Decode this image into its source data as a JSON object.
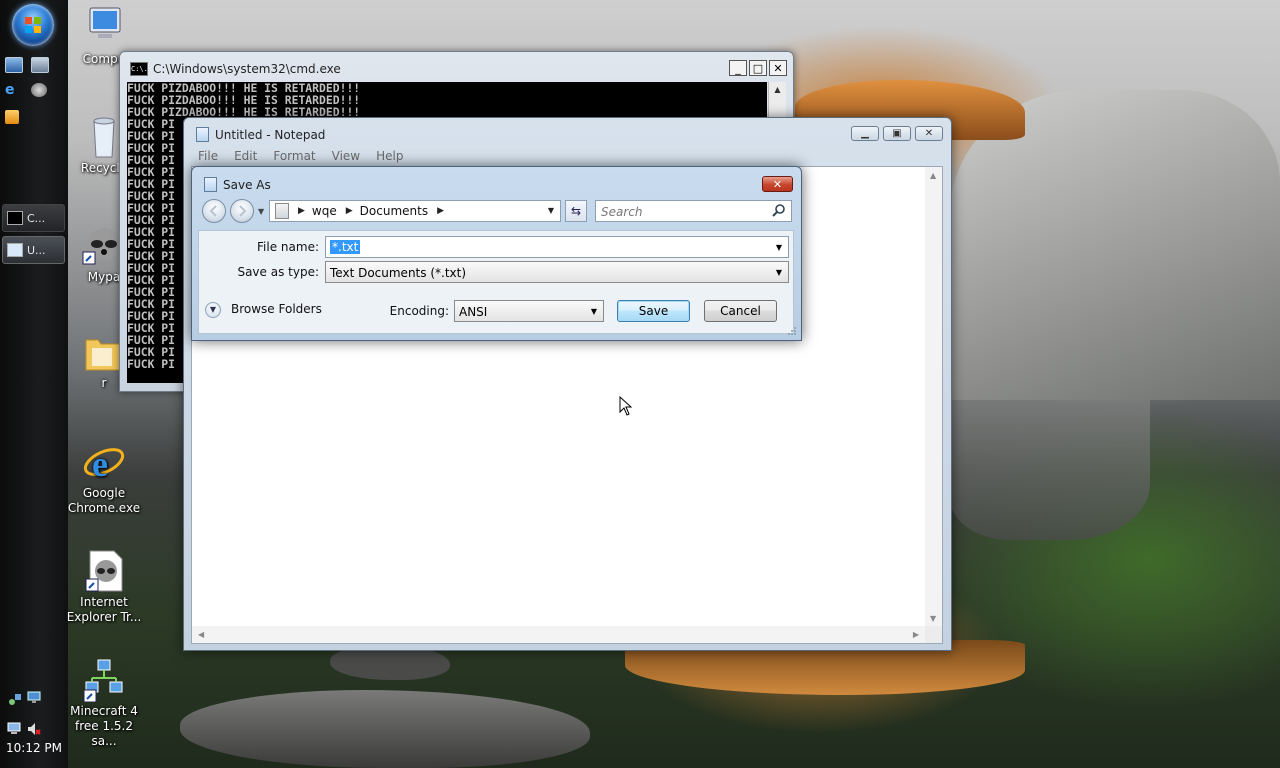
{
  "taskbar": {
    "task_buttons": [
      {
        "label": "C..."
      },
      {
        "label": "U..."
      }
    ],
    "clock": "10:12 PM"
  },
  "desktop_icons": [
    {
      "label": "Compu"
    },
    {
      "label": "Recycle"
    },
    {
      "label": "Mypa"
    },
    {
      "label": "r"
    },
    {
      "label": "Google Chrome.exe"
    },
    {
      "label": "Internet Explorer Tr..."
    },
    {
      "label": "Minecraft 4 free 1.5.2 sa..."
    }
  ],
  "cmd": {
    "title": "C:\\Windows\\system32\\cmd.exe",
    "icon_text": "C:\\.",
    "full_line": "FUCK PIZDABOO!!! HE IS RETARDED!!!",
    "partial_line": "FUCK PI",
    "full_line_count": 3,
    "partial_line_count": 21
  },
  "notepad": {
    "title": "Untitled - Notepad",
    "menu": [
      "File",
      "Edit",
      "Format",
      "View",
      "Help"
    ]
  },
  "save_as": {
    "title": "Save As",
    "breadcrumb": [
      "wqe",
      "Documents"
    ],
    "search_placeholder": "Search",
    "file_name_label": "File name:",
    "file_name_value": "*.txt",
    "save_as_type_label": "Save as type:",
    "save_as_type_value": "Text Documents (*.txt)",
    "browse_folders": "Browse Folders",
    "encoding_label": "Encoding:",
    "encoding_value": "ANSI",
    "save_button": "Save",
    "cancel_button": "Cancel"
  },
  "colors": {
    "selection": "#3399ff",
    "console_bg": "#000000",
    "console_text": "#c0c0c0"
  }
}
